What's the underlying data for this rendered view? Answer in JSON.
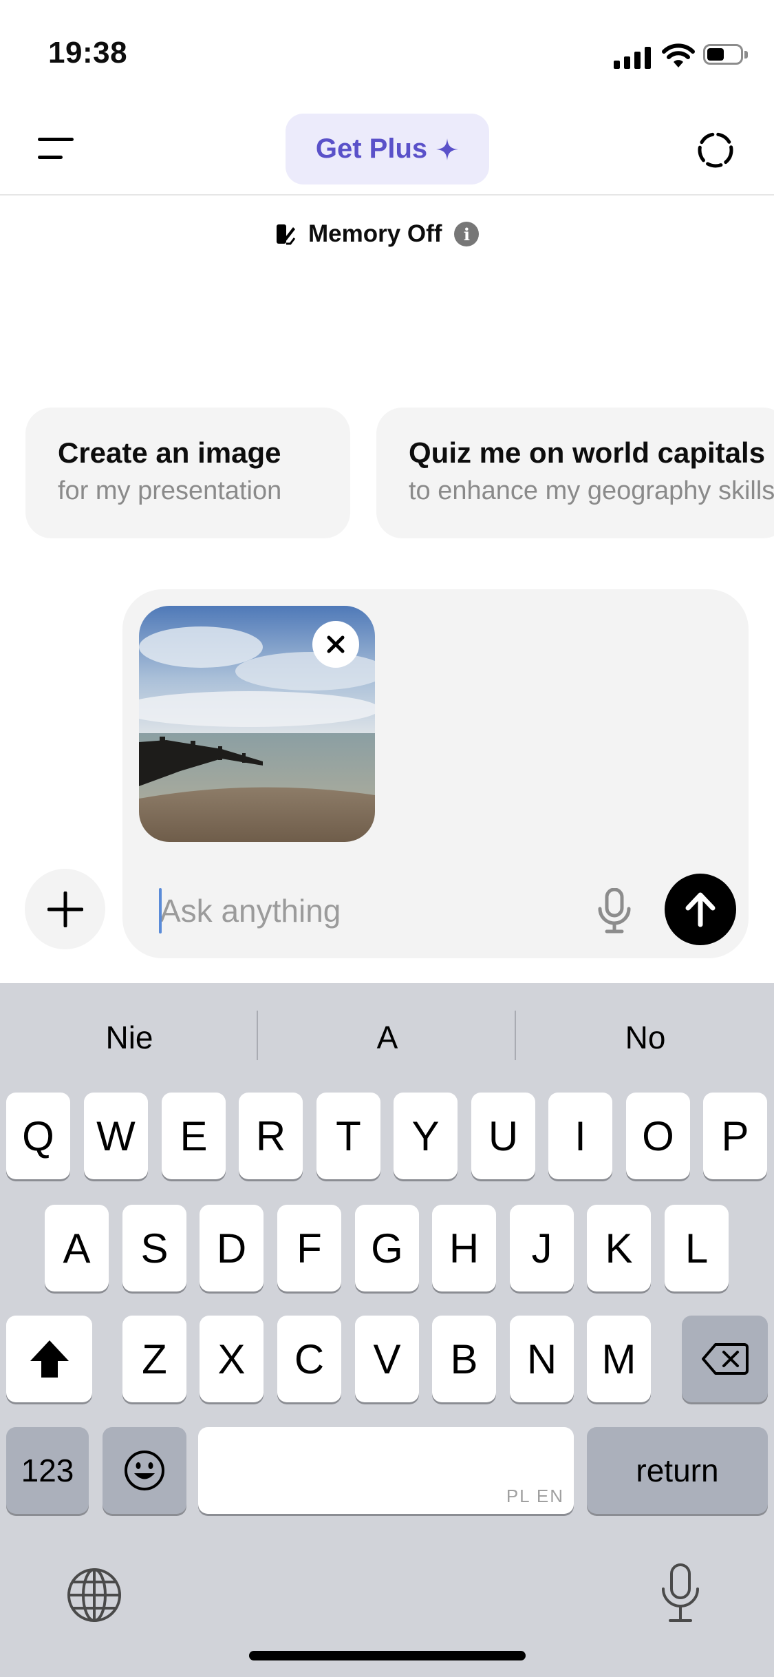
{
  "status_bar": {
    "time": "19:38"
  },
  "header": {
    "get_plus_label": "Get Plus",
    "get_plus_icon": "sparkle-icon"
  },
  "memory": {
    "label": "Memory Off",
    "info_glyph": "i"
  },
  "suggestions": [
    {
      "title": "Create an image",
      "subtitle": "for my presentation"
    },
    {
      "title": "Quiz me on world capitals",
      "subtitle": "to enhance my geography skills"
    }
  ],
  "composer": {
    "placeholder": "Ask anything",
    "attachment": "beach-photo"
  },
  "keyboard": {
    "suggestions": [
      "Nie",
      "A",
      "No"
    ],
    "row1": [
      "Q",
      "W",
      "E",
      "R",
      "T",
      "Y",
      "U",
      "I",
      "O",
      "P"
    ],
    "row2": [
      "A",
      "S",
      "D",
      "F",
      "G",
      "H",
      "J",
      "K",
      "L"
    ],
    "row3": [
      "Z",
      "X",
      "C",
      "V",
      "B",
      "N",
      "M"
    ],
    "numbers_label": "123",
    "return_label": "return",
    "space_languages": "PL EN"
  },
  "colors": {
    "accent": "#5a51c9",
    "accent_bg": "#ecebfb",
    "keyboard_bg": "#d1d3d9"
  }
}
